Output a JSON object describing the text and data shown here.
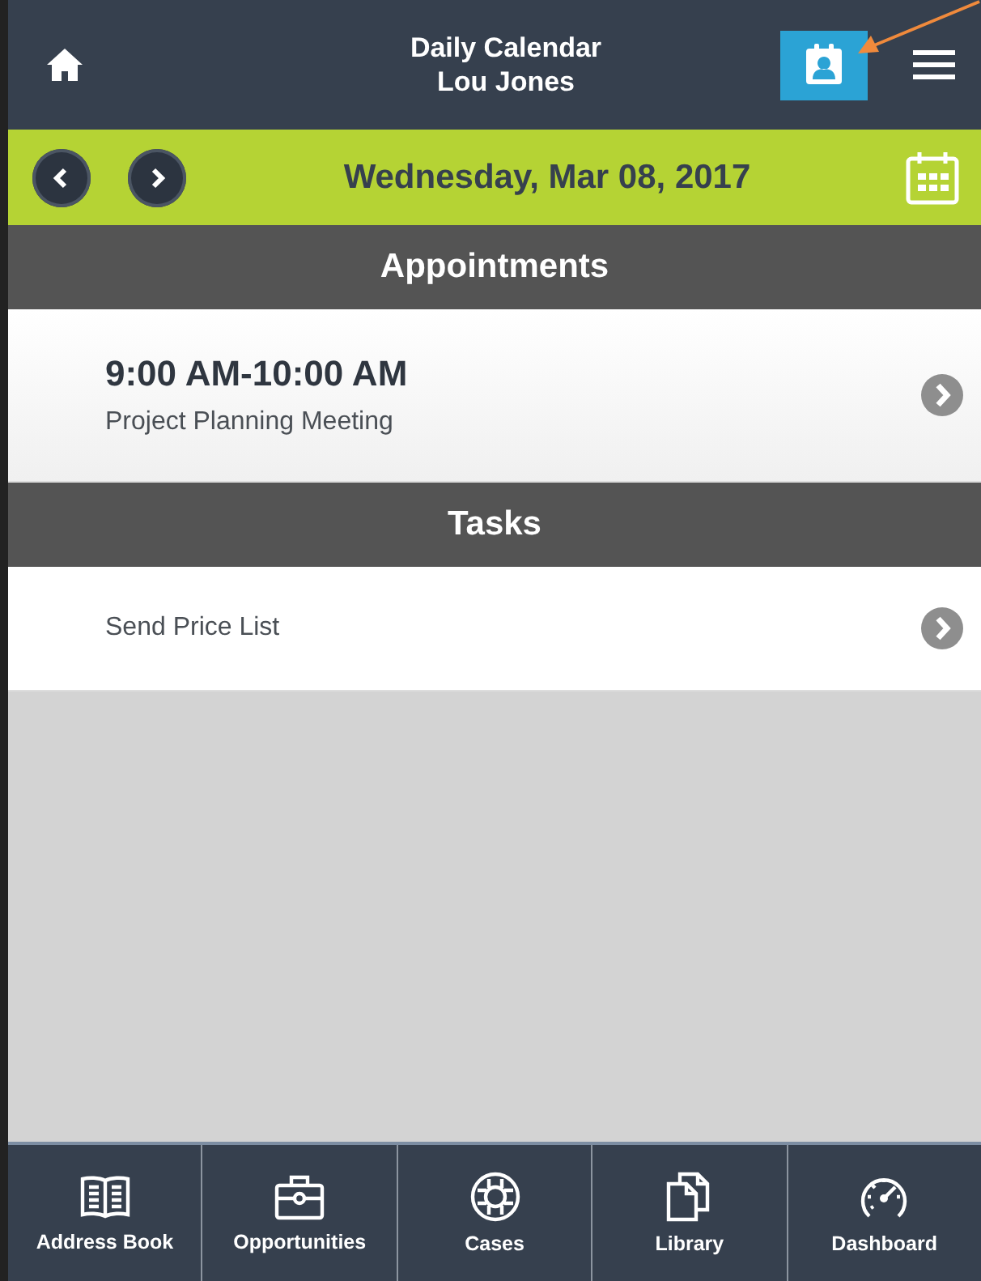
{
  "header": {
    "title": "Daily Calendar",
    "subtitle": "Lou Jones"
  },
  "date_bar": {
    "date": "Wednesday, Mar 08, 2017"
  },
  "appointments": {
    "heading": "Appointments",
    "items": [
      {
        "time": "9:00 AM-10:00 AM",
        "title": "Project Planning Meeting"
      }
    ]
  },
  "tasks": {
    "heading": "Tasks",
    "items": [
      {
        "title": "Send Price List"
      }
    ]
  },
  "tab_bar": [
    {
      "label": "Address Book"
    },
    {
      "label": "Opportunities"
    },
    {
      "label": "Cases"
    },
    {
      "label": "Library"
    },
    {
      "label": "Dashboard"
    }
  ]
}
